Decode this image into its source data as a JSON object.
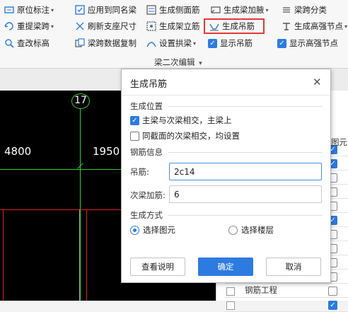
{
  "ribbon": {
    "row1": [
      {
        "label": "原位标注",
        "icon": "in-place-annotation-icon",
        "dropdown": true
      },
      {
        "label": "应用到同名梁",
        "icon": "apply-same-name-icon",
        "dropdown": false
      },
      {
        "label": "生成侧面筋",
        "icon": "side-rebar-icon",
        "dropdown": false
      },
      {
        "label": "生成梁加腋",
        "icon": "haunch-icon",
        "dropdown": true
      },
      {
        "label": "梁跨分类",
        "icon": "span-classify-icon",
        "dropdown": false
      }
    ],
    "row2": [
      {
        "label": "重提梁跨",
        "icon": "re-extract-span-icon",
        "dropdown": true
      },
      {
        "label": "刷新支座尺寸",
        "icon": "refresh-support-icon",
        "dropdown": false
      },
      {
        "label": "生成架立筋",
        "icon": "erection-rebar-icon",
        "dropdown": false
      },
      {
        "label": "生成吊筋",
        "icon": "hanger-rebar-icon",
        "dropdown": false
      },
      {
        "label": "生成高强节点",
        "icon": "high-strength-node-icon",
        "dropdown": true
      }
    ],
    "row3": [
      {
        "label": "查改标高",
        "icon": "elevation-edit-icon",
        "dropdown": false
      },
      {
        "label": "梁跨数据复制",
        "icon": "span-copy-icon",
        "dropdown": false
      },
      {
        "label": "设置拱梁",
        "icon": "arch-beam-icon",
        "dropdown": true
      },
      {
        "label": "显示吊筋",
        "checked": true
      },
      {
        "label": "显示高强节点",
        "checked": true
      }
    ],
    "group_label": "梁二次编辑",
    "group_dropdown": "▾"
  },
  "canvas": {
    "axis_label": "17",
    "dimension_left": "4800",
    "dimension_right": "1950"
  },
  "panel": {
    "header_text": "图元",
    "last_item": "钢筋工程",
    "rows_checked": [
      true,
      true,
      false,
      false,
      false,
      true,
      false,
      false,
      false,
      false,
      false,
      true
    ]
  },
  "dialog": {
    "title": "生成吊筋",
    "section_position": "生成位置",
    "check_main_secondary": "主梁与次梁相交，主梁上",
    "check_main_secondary_checked": true,
    "check_same_section": "同截面的次梁相交，均设置",
    "check_same_section_checked": false,
    "section_rebar": "钢筋信息",
    "hanger_label": "吊筋:",
    "hanger_value": "2c14",
    "secondary_label": "次梁加筋:",
    "secondary_value": "6",
    "section_mode": "生成方式",
    "radio_select_element": "选择图元",
    "radio_select_element_checked": true,
    "radio_select_floor": "选择楼层",
    "radio_select_floor_checked": false,
    "btn_help": "查看说明",
    "btn_ok": "确定",
    "btn_cancel": "取消"
  },
  "colors": {
    "accent": "#2d7be0",
    "highlight": "#e53935",
    "canvas_bg": "#000000",
    "grid_green": "#2fd12f",
    "axis_red": "#e02020"
  }
}
